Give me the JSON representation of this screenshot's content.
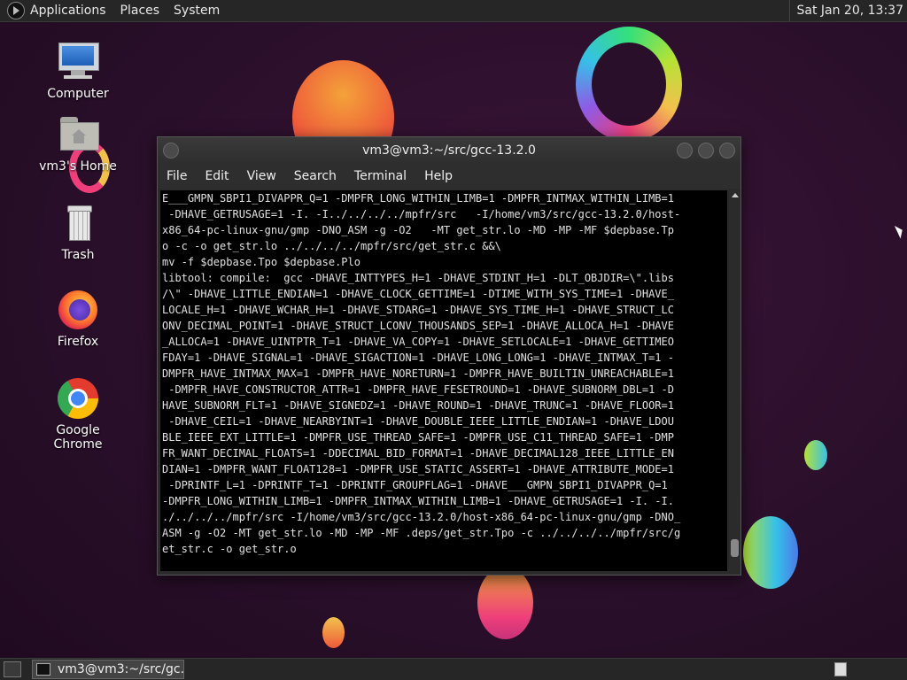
{
  "top_panel": {
    "menus": [
      "Applications",
      "Places",
      "System"
    ],
    "clock": "Sat Jan 20, 13:37"
  },
  "desktop_icons": [
    {
      "label": "Computer",
      "icon": "computer-icon"
    },
    {
      "label": "vm3's Home",
      "icon": "home-folder-icon"
    },
    {
      "label": "Trash",
      "icon": "trash-icon"
    },
    {
      "label": "Firefox",
      "icon": "firefox-icon"
    },
    {
      "label": "Google Chrome",
      "icon": "chrome-icon"
    }
  ],
  "terminal": {
    "title": "vm3@vm3:~/src/gcc-13.2.0",
    "menu": [
      "File",
      "Edit",
      "View",
      "Search",
      "Terminal",
      "Help"
    ],
    "output": "E___GMPN_SBPI1_DIVAPPR_Q=1 -DMPFR_LONG_WITHIN_LIMB=1 -DMPFR_INTMAX_WITHIN_LIMB=1\n -DHAVE_GETRUSAGE=1 -I. -I../../../../mpfr/src   -I/home/vm3/src/gcc-13.2.0/host-\nx86_64-pc-linux-gnu/gmp -DNO_ASM -g -O2   -MT get_str.lo -MD -MP -MF $depbase.Tp\no -c -o get_str.lo ../../../../mpfr/src/get_str.c &&\\\nmv -f $depbase.Tpo $depbase.Plo\nlibtool: compile:  gcc -DHAVE_INTTYPES_H=1 -DHAVE_STDINT_H=1 -DLT_OBJDIR=\\\".libs\n/\\\" -DHAVE_LITTLE_ENDIAN=1 -DHAVE_CLOCK_GETTIME=1 -DTIME_WITH_SYS_TIME=1 -DHAVE_\nLOCALE_H=1 -DHAVE_WCHAR_H=1 -DHAVE_STDARG=1 -DHAVE_SYS_TIME_H=1 -DHAVE_STRUCT_LC\nONV_DECIMAL_POINT=1 -DHAVE_STRUCT_LCONV_THOUSANDS_SEP=1 -DHAVE_ALLOCA_H=1 -DHAVE\n_ALLOCA=1 -DHAVE_UINTPTR_T=1 -DHAVE_VA_COPY=1 -DHAVE_SETLOCALE=1 -DHAVE_GETTIMEO\nFDAY=1 -DHAVE_SIGNAL=1 -DHAVE_SIGACTION=1 -DHAVE_LONG_LONG=1 -DHAVE_INTMAX_T=1 -\nDMPFR_HAVE_INTMAX_MAX=1 -DMPFR_HAVE_NORETURN=1 -DMPFR_HAVE_BUILTIN_UNREACHABLE=1\n -DMPFR_HAVE_CONSTRUCTOR_ATTR=1 -DMPFR_HAVE_FESETROUND=1 -DHAVE_SUBNORM_DBL=1 -D\nHAVE_SUBNORM_FLT=1 -DHAVE_SIGNEDZ=1 -DHAVE_ROUND=1 -DHAVE_TRUNC=1 -DHAVE_FLOOR=1\n -DHAVE_CEIL=1 -DHAVE_NEARBYINT=1 -DHAVE_DOUBLE_IEEE_LITTLE_ENDIAN=1 -DHAVE_LDOU\nBLE_IEEE_EXT_LITTLE=1 -DMPFR_USE_THREAD_SAFE=1 -DMPFR_USE_C11_THREAD_SAFE=1 -DMP\nFR_WANT_DECIMAL_FLOATS=1 -DDECIMAL_BID_FORMAT=1 -DHAVE_DECIMAL128_IEEE_LITTLE_EN\nDIAN=1 -DMPFR_WANT_FLOAT128=1 -DMPFR_USE_STATIC_ASSERT=1 -DHAVE_ATTRIBUTE_MODE=1\n -DPRINTF_L=1 -DPRINTF_T=1 -DPRINTF_GROUPFLAG=1 -DHAVE___GMPN_SBPI1_DIVAPPR_Q=1\n-DMPFR_LONG_WITHIN_LIMB=1 -DMPFR_INTMAX_WITHIN_LIMB=1 -DHAVE_GETRUSAGE=1 -I. -I.\n./../../../mpfr/src -I/home/vm3/src/gcc-13.2.0/host-x86_64-pc-linux-gnu/gmp -DNO_\nASM -g -O2 -MT get_str.lo -MD -MP -MF .deps/get_str.Tpo -c ../../../../mpfr/src/g\net_str.c -o get_str.o"
  },
  "taskbar": {
    "task_label": "vm3@vm3:~/src/gc..."
  }
}
